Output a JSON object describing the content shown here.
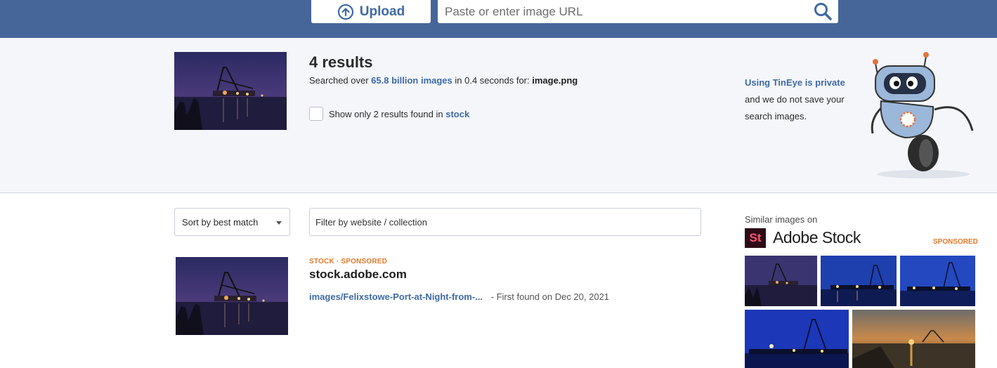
{
  "header": {
    "upload_label": "Upload",
    "url_placeholder": "Paste or enter image URL"
  },
  "summary": {
    "results_count": "4 results",
    "searched_prefix": "Searched over ",
    "searched_count": "65.8 billion images",
    "searched_middle": " in 0.4 seconds for: ",
    "searched_file": "image.png",
    "stock_filter_prefix": "Show only 2 results found in ",
    "stock_filter_link": "stock",
    "privacy_link": "Using TinEye is private",
    "privacy_line2": "and we do not save your",
    "privacy_line3": "search images."
  },
  "filters": {
    "sort_label": "Sort by best match",
    "filter_placeholder": "Filter by website / collection"
  },
  "results": [
    {
      "tag_stock": "STOCK",
      "tag_sep": "·",
      "tag_sponsored": "SPONSORED",
      "domain": "stock.adobe.com",
      "path": "images/Felixstowe-Port-at-Night-from-...",
      "found": "- First found on Dec 20, 2021"
    }
  ],
  "sidebar": {
    "similar_label": "Similar images on",
    "logo_text": "St",
    "brand": "Adobe Stock",
    "sponsored": "SPONSORED"
  },
  "colors": {
    "header_bg": "#46669a",
    "link": "#3e6aa5",
    "sponsored": "#e07a2d",
    "summary_bg": "#f4f6fa"
  }
}
